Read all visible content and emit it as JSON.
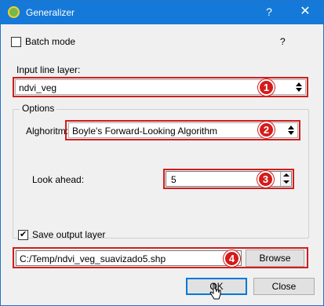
{
  "window": {
    "title": "Generalizer",
    "help_symbol": "?",
    "close_symbol": "✕"
  },
  "batch": {
    "label": "Batch mode",
    "checked": false,
    "help_symbol": "?"
  },
  "input_layer": {
    "label": "Input line layer:",
    "value": "ndvi_veg"
  },
  "options": {
    "title": "Options",
    "algorithm_label": "Alghoritm:",
    "algorithm_value": "Boyle's Forward-Looking Algorithm",
    "lookahead_label": "Look ahead:",
    "lookahead_value": "5"
  },
  "output": {
    "label": "Save output layer",
    "checked": true,
    "path": "C:/Temp/ndvi_veg_suavizado5.shp",
    "browse_label": "Browse"
  },
  "buttons": {
    "ok_label": "OK",
    "close_label": "Close"
  },
  "callouts": [
    "1",
    "2",
    "3",
    "4"
  ],
  "colors": {
    "titlebar": "#1579d9",
    "callout": "#d31c1c",
    "dialog_bg": "#f0f0f0"
  }
}
